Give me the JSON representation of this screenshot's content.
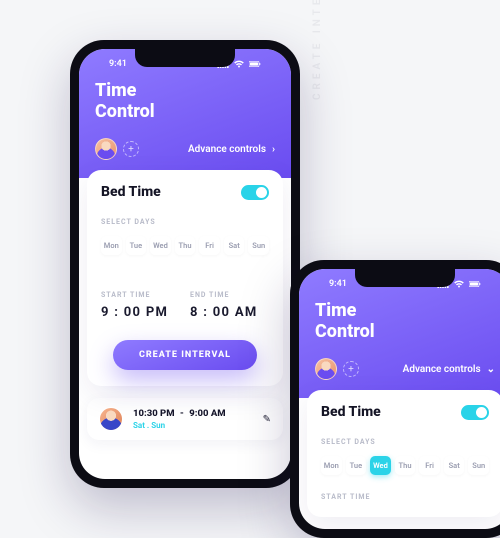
{
  "side_label": "CREATE INTERVAL",
  "status": {
    "time": "9:41"
  },
  "header": {
    "title_line1": "Time",
    "title_line2": "Control",
    "add_glyph": "+",
    "advance_label": "Advance controls",
    "chev_right": "›",
    "chev_down": "⌄"
  },
  "card": {
    "title": "Bed Time",
    "select_days_label": "SELECT DAYS",
    "days": [
      "Mon",
      "Tue",
      "Wed",
      "Thu",
      "Fri",
      "Sat",
      "Sun"
    ],
    "start_label": "START TIME",
    "end_label": "END TIME",
    "start_time": "9 : 00 PM",
    "end_time": "8 : 00 AM",
    "cta": "CREATE INTERVAL"
  },
  "entry": {
    "start": "10:30 PM",
    "sep": "-",
    "end": "9:00 AM",
    "days": "Sat . Sun",
    "edit_glyph": "✎"
  },
  "phone_b": {
    "selected_day_index": 2,
    "start_label": "START TIME"
  }
}
